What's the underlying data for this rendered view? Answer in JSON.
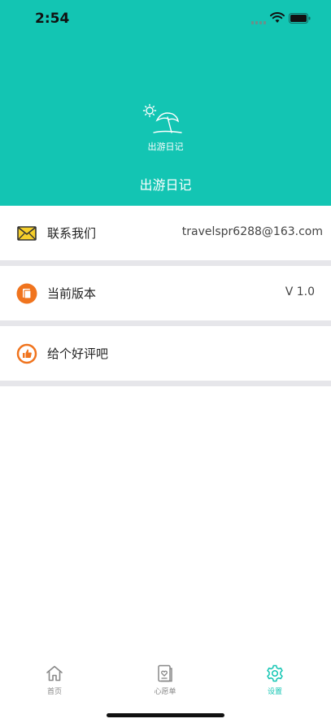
{
  "status_bar": {
    "time": "2:54"
  },
  "header": {
    "logo_caption": "出游日记",
    "title": "出游日记"
  },
  "settings": [
    {
      "label": "联系我们",
      "value": "travelspr6288@163.com",
      "icon": "envelope-icon"
    },
    {
      "label": "当前版本",
      "value": "V 1.0",
      "icon": "version-icon"
    },
    {
      "label": "给个好评吧",
      "value": "",
      "icon": "thumbs-up-icon"
    }
  ],
  "tabbar": {
    "items": [
      {
        "label": "首页",
        "icon": "home-icon",
        "active": false
      },
      {
        "label": "心愿单",
        "icon": "wishlist-icon",
        "active": false
      },
      {
        "label": "设置",
        "icon": "gear-icon",
        "active": true
      }
    ]
  },
  "colors": {
    "accent": "#13c5b3",
    "divider": "#e6e6ea",
    "icon_orange": "#f0741e"
  }
}
